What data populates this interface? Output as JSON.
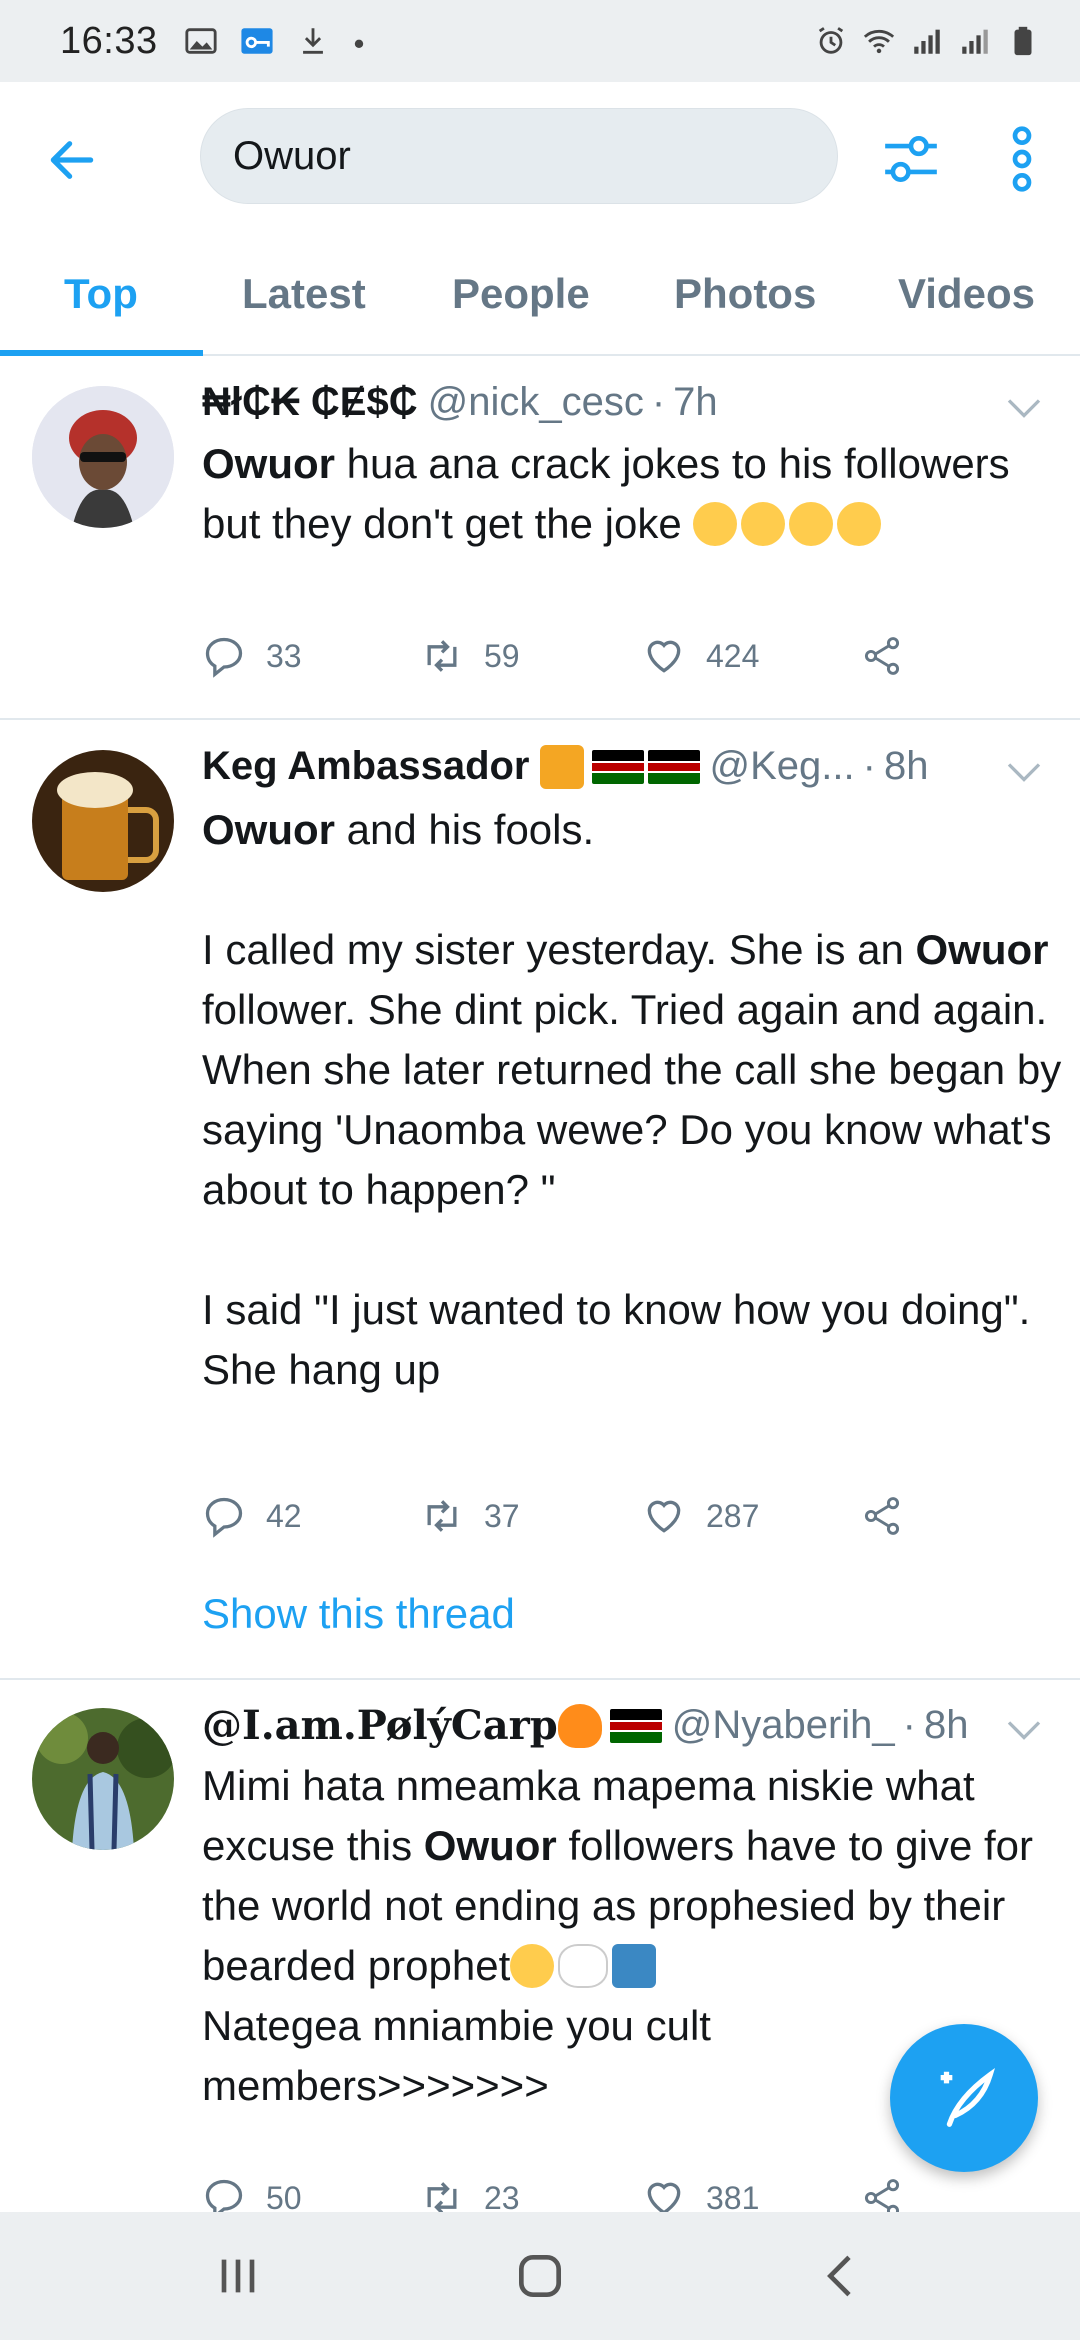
{
  "status_bar": {
    "time": "16:33",
    "icons": [
      "gallery-icon",
      "vpn-key-icon",
      "download-icon",
      "dot-icon",
      "alarm-icon",
      "wifi-icon",
      "signal-icon",
      "signal-icon",
      "battery-icon"
    ]
  },
  "search": {
    "query": "Owuor"
  },
  "tabs": [
    {
      "label": "Top",
      "active": true
    },
    {
      "label": "Latest",
      "active": false
    },
    {
      "label": "People",
      "active": false
    },
    {
      "label": "Photos",
      "active": false
    },
    {
      "label": "Videos",
      "active": false
    }
  ],
  "tweets": [
    {
      "name": "₦ł₵₭ ₵Ɇ$₵",
      "handle": "@nick_cesc",
      "separator": "·",
      "age": "7h",
      "body_parts": [
        "Owuor",
        " hua ana crack jokes to his followers but they don't get the joke "
      ],
      "replies": "33",
      "retweets": "59",
      "likes": "424"
    },
    {
      "name": "Keg Ambassador",
      "handle": "@Keg...",
      "separator": "·",
      "age": "8h",
      "body_parts": [
        "Owuor",
        " and his fools.\n\nI called my sister yesterday. She is an ",
        "Owuor",
        " follower. She dint pick. Tried again and again. When she later returned the call she began by saying 'Unaomba wewe? Do you know what's about to happen? \"\n\nI said \"I just wanted to know how you doing\". She hang up"
      ],
      "replies": "42",
      "retweets": "37",
      "likes": "287",
      "show_thread": "Show this thread"
    },
    {
      "name": "@I.am.PølýCarp",
      "handle": "@Nyaberih_",
      "separator": "·",
      "age": "8h",
      "body_parts": [
        "Mimi hata nmeamka mapema niskie what excuse this ",
        "Owuor",
        " followers have to give for the world not ending as prophesied by their bearded prophet",
        "\nNategea mniambie you cult members>>>>>>>"
      ],
      "replies": "50",
      "retweets": "23",
      "likes": "381"
    }
  ],
  "colors": {
    "accent": "#1da1f2",
    "text": "#14171a",
    "muted": "#657786",
    "divider": "#e1e8ed"
  }
}
